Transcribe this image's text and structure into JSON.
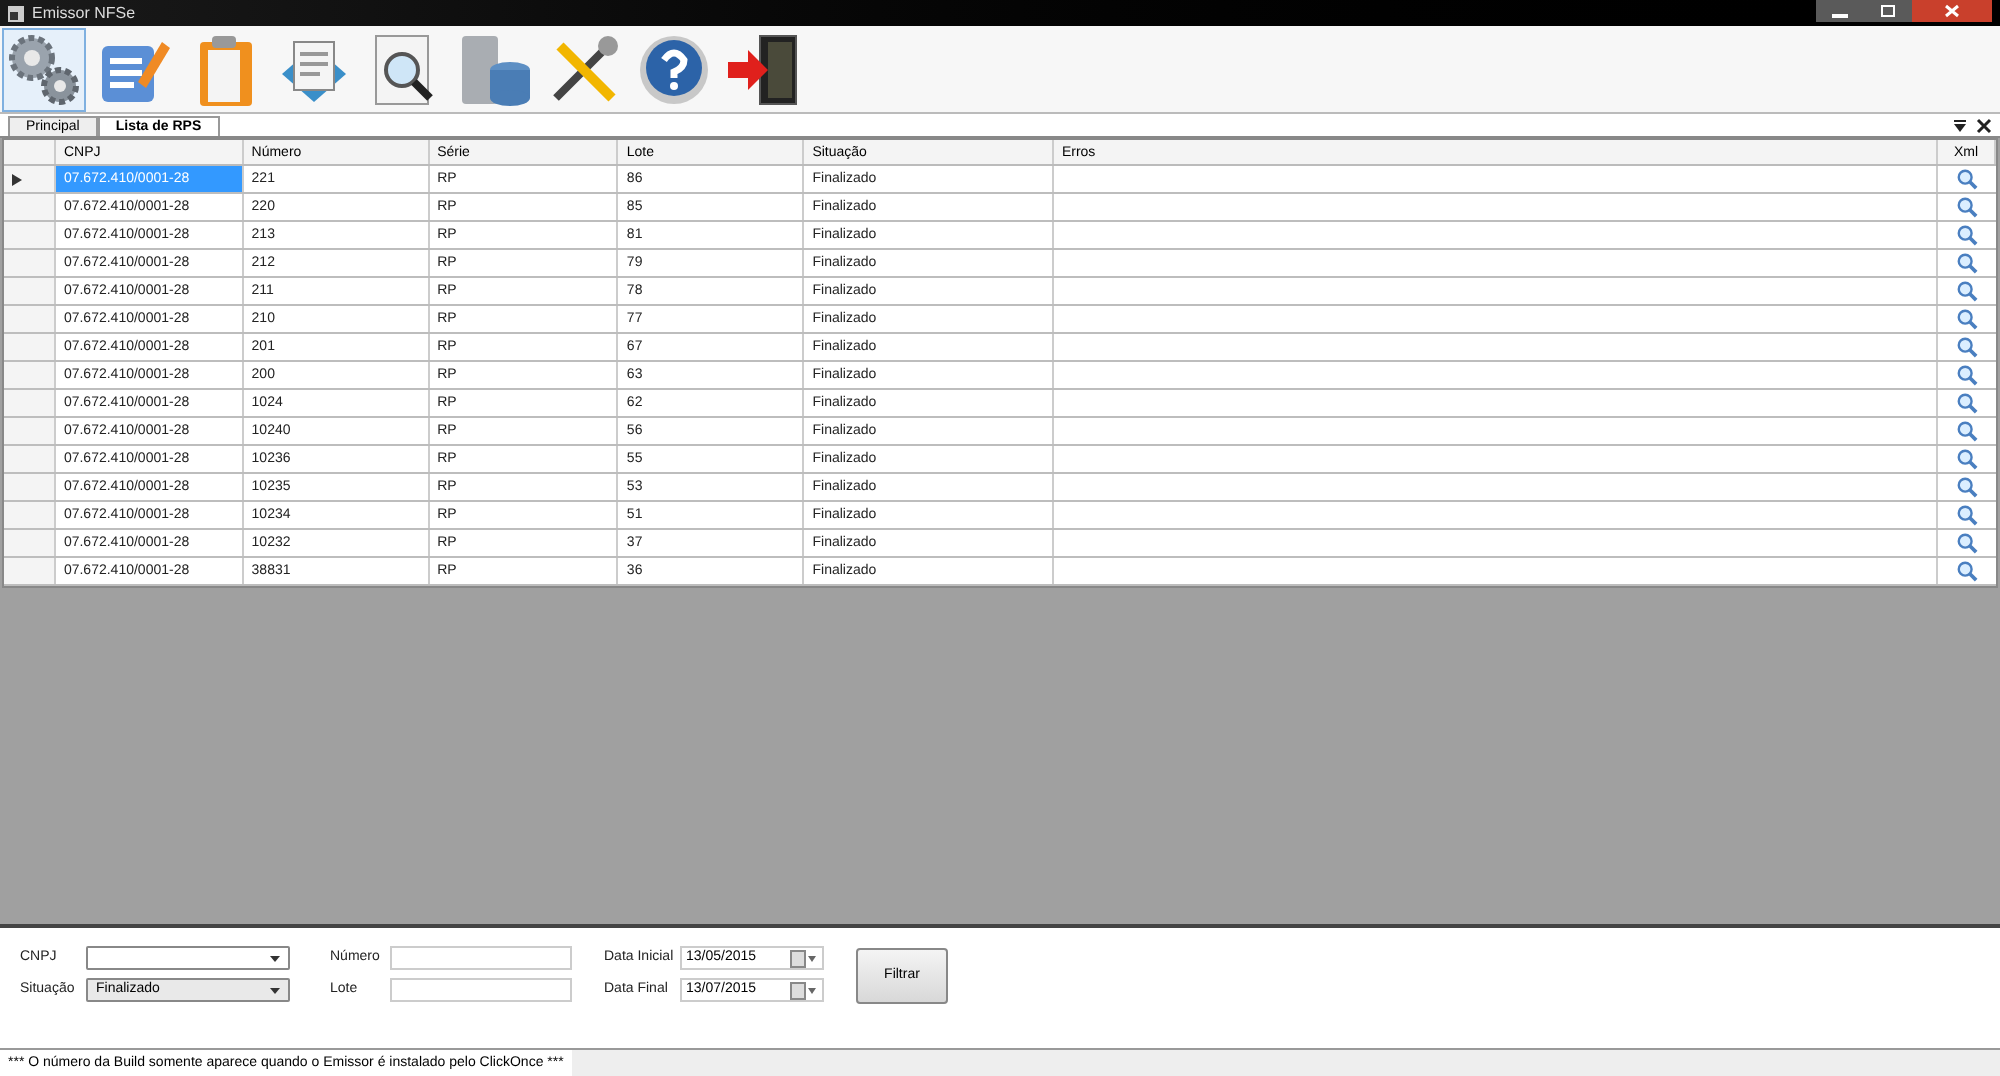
{
  "window": {
    "title": "Emissor NFSe"
  },
  "toolbar": [
    {
      "kind": "gears",
      "selected": true
    },
    {
      "kind": "edit",
      "selected": false
    },
    {
      "kind": "clipboard",
      "selected": false
    },
    {
      "kind": "documents",
      "selected": false
    },
    {
      "kind": "preview",
      "selected": false
    },
    {
      "kind": "database",
      "selected": false
    },
    {
      "kind": "tools",
      "selected": false
    },
    {
      "kind": "help",
      "selected": false
    },
    {
      "kind": "exit",
      "selected": false
    }
  ],
  "tabs": [
    {
      "label": "Principal",
      "selected": false
    },
    {
      "label": "Lista de RPS",
      "selected": true
    }
  ],
  "table": {
    "columns": [
      "CNPJ",
      "Número",
      "Série",
      "Lote",
      "Situação",
      "Erros",
      "Xml"
    ],
    "rows": [
      {
        "selected": true,
        "cells": [
          "07.672.410/0001-28",
          "221",
          "RP",
          "86",
          "Finalizado"
        ]
      },
      {
        "selected": false,
        "cells": [
          "07.672.410/0001-28",
          "220",
          "RP",
          "85",
          "Finalizado"
        ]
      },
      {
        "selected": false,
        "cells": [
          "07.672.410/0001-28",
          "213",
          "RP",
          "81",
          "Finalizado"
        ]
      },
      {
        "selected": false,
        "cells": [
          "07.672.410/0001-28",
          "212",
          "RP",
          "79",
          "Finalizado"
        ]
      },
      {
        "selected": false,
        "cells": [
          "07.672.410/0001-28",
          "211",
          "RP",
          "78",
          "Finalizado"
        ]
      },
      {
        "selected": false,
        "cells": [
          "07.672.410/0001-28",
          "210",
          "RP",
          "77",
          "Finalizado"
        ]
      },
      {
        "selected": false,
        "cells": [
          "07.672.410/0001-28",
          "201",
          "RP",
          "67",
          "Finalizado"
        ]
      },
      {
        "selected": false,
        "cells": [
          "07.672.410/0001-28",
          "200",
          "RP",
          "63",
          "Finalizado"
        ]
      },
      {
        "selected": false,
        "cells": [
          "07.672.410/0001-28",
          "1024",
          "RP",
          "62",
          "Finalizado"
        ]
      },
      {
        "selected": false,
        "cells": [
          "07.672.410/0001-28",
          "10240",
          "RP",
          "56",
          "Finalizado"
        ]
      },
      {
        "selected": false,
        "cells": [
          "07.672.410/0001-28",
          "10236",
          "RP",
          "55",
          "Finalizado"
        ]
      },
      {
        "selected": false,
        "cells": [
          "07.672.410/0001-28",
          "10235",
          "RP",
          "53",
          "Finalizado"
        ]
      },
      {
        "selected": false,
        "cells": [
          "07.672.410/0001-28",
          "10234",
          "RP",
          "51",
          "Finalizado"
        ]
      },
      {
        "selected": false,
        "cells": [
          "07.672.410/0001-28",
          "10232",
          "RP",
          "37",
          "Finalizado"
        ]
      },
      {
        "selected": false,
        "cells": [
          "07.672.410/0001-28",
          "38831",
          "RP",
          "36",
          "Finalizado"
        ]
      }
    ]
  },
  "filter": {
    "cnpj": {
      "label": "CNPJ"
    },
    "situacao": {
      "label": "Situação",
      "value": "Finalizado"
    },
    "numero": {
      "label": "Número"
    },
    "lote": {
      "label": "Lote"
    },
    "data_inicial": {
      "label": "Data Inicial",
      "value": "13/05/2015"
    },
    "data_final": {
      "label": "Data Final",
      "value": "13/07/2015"
    },
    "button": "Filtrar"
  },
  "status_bar": "*** O número da Build somente aparece quando o Emissor é instalado pelo ClickOnce ***"
}
